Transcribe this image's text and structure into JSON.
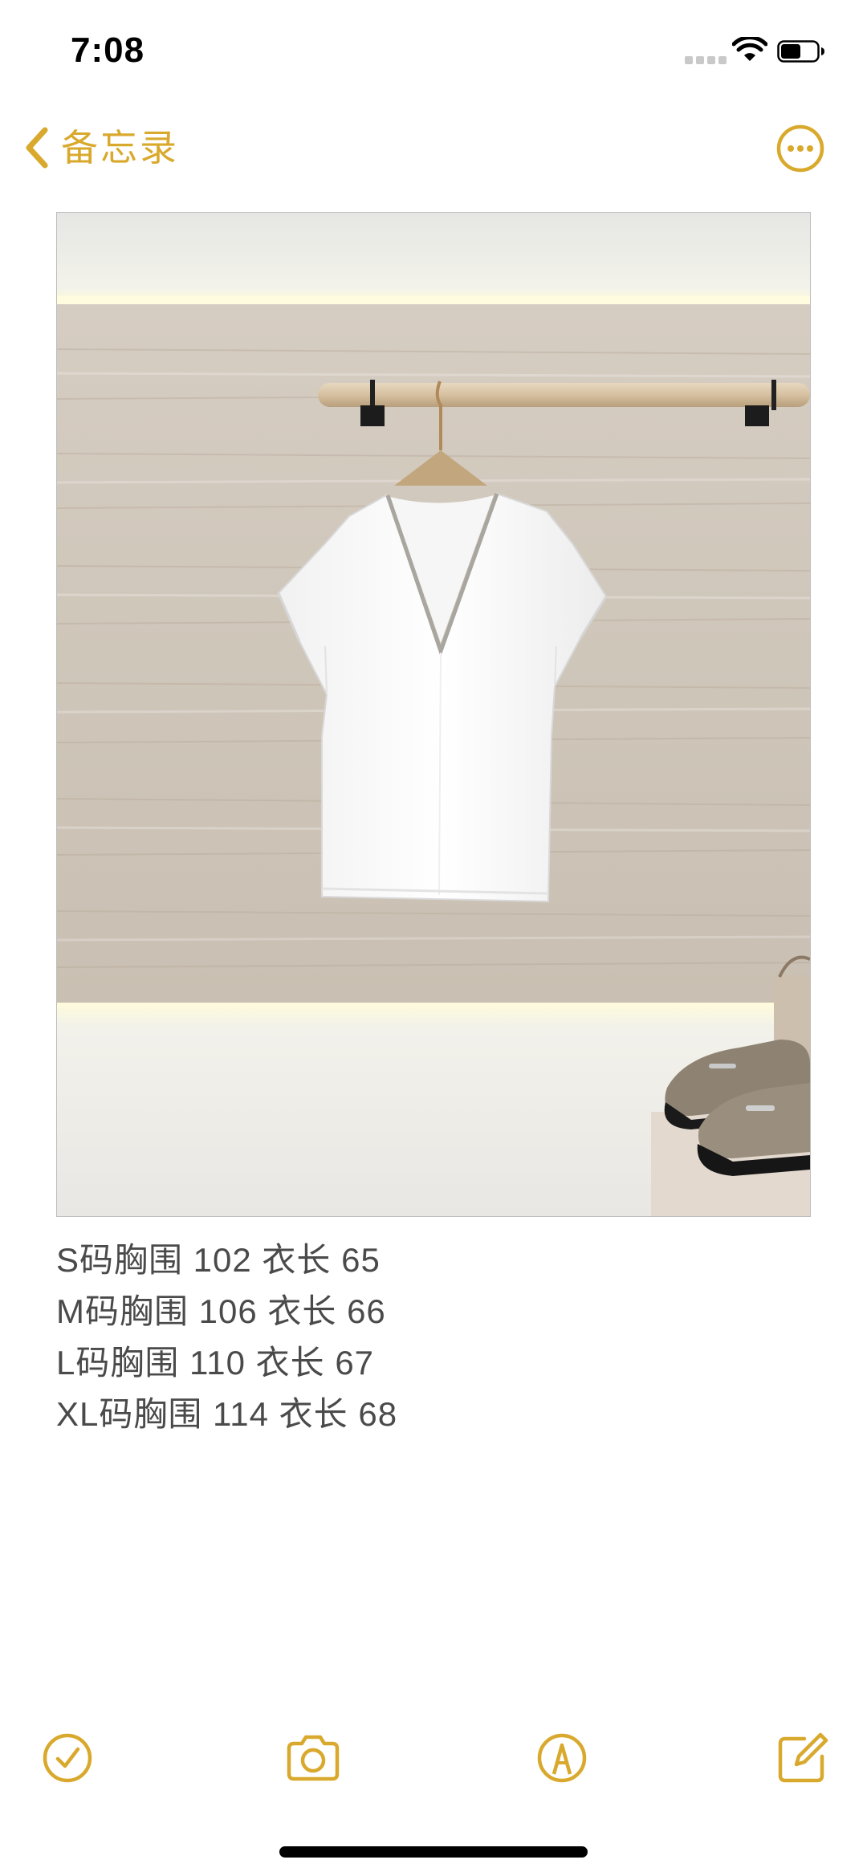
{
  "status_bar": {
    "time": "7:08"
  },
  "nav": {
    "back_label": "备忘录",
    "back_icon": "chevron-left-icon",
    "more_icon": "ellipsis-circle-icon"
  },
  "note": {
    "image_alt": "photo-white-vneck-tshirt",
    "lines": [
      "S码胸围 102 衣长 65",
      "M码胸围 106 衣长 66",
      "L码胸围 110 衣长 67",
      "XL码胸围 114 衣长 68"
    ]
  },
  "toolbar": {
    "items": [
      {
        "icon": "checklist-icon"
      },
      {
        "icon": "camera-icon"
      },
      {
        "icon": "markup-pen-icon"
      },
      {
        "icon": "compose-icon"
      }
    ]
  },
  "colors": {
    "accent": "#d9a92d",
    "text": "#4a4a4a",
    "background": "#ffffff"
  }
}
